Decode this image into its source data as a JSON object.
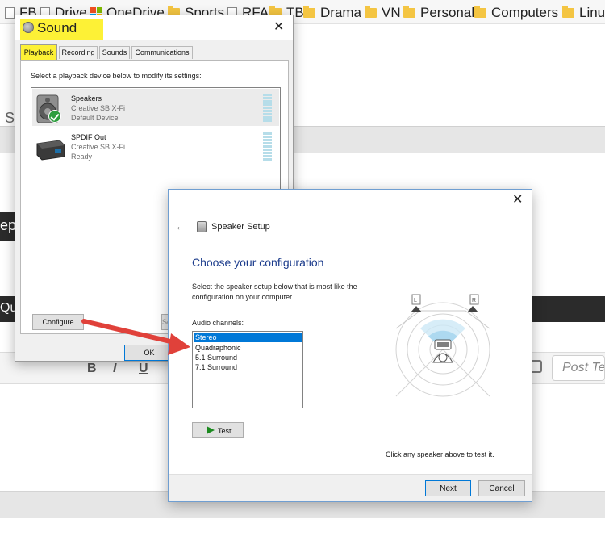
{
  "bookmarks": [
    {
      "label": "FB",
      "icon": "page-icon"
    },
    {
      "label": "Drive",
      "icon": "page-icon"
    },
    {
      "label": "OneDrive",
      "icon": "microsoft-icon"
    },
    {
      "label": "Sports",
      "icon": "folder-icon"
    },
    {
      "label": "RFA",
      "icon": "page-icon"
    },
    {
      "label": "TB",
      "icon": "folder-icon"
    },
    {
      "label": "Drama",
      "icon": "folder-icon"
    },
    {
      "label": "VN",
      "icon": "folder-icon"
    },
    {
      "label": "Personal",
      "icon": "folder-icon"
    },
    {
      "label": "Computers",
      "icon": "folder-icon"
    },
    {
      "label": "Linux",
      "icon": "folder-icon"
    }
  ],
  "background": {
    "sy_fragment": "Sy",
    "ep_fragment": "ep",
    "qu_fragment": "Qu",
    "post_text_placeholder": "Post Te",
    "tool_bold": "B",
    "tool_italic": "I",
    "tool_underline": "U"
  },
  "sound": {
    "title": "Sound",
    "close": "✕",
    "tabs": [
      "Playback",
      "Recording",
      "Sounds",
      "Communications"
    ],
    "active_tab": "Playback",
    "instruction": "Select a playback device below to modify its settings:",
    "devices": [
      {
        "name": "Speakers",
        "card": "Creative SB X-Fi",
        "status": "Default Device",
        "default": true
      },
      {
        "name": "SPDIF Out",
        "card": "Creative SB X-Fi",
        "status": "Ready",
        "default": false
      }
    ],
    "configure_label": "Configure",
    "set_default_fragment": "Se",
    "ok_label": "OK"
  },
  "setup": {
    "close": "✕",
    "back": "←",
    "title": "Speaker Setup",
    "heading": "Choose your configuration",
    "description": "Select the speaker setup below that is most like the configuration on your computer.",
    "channels_label": "Audio channels:",
    "channels": [
      "Stereo",
      "Quadraphonic",
      "5.1 Surround",
      "7.1 Surround"
    ],
    "selected_channel": "Stereo",
    "test_label": "Test",
    "hint": "Click any speaker above to test it.",
    "next_label": "Next",
    "cancel_label": "Cancel",
    "speaker_left": "L",
    "speaker_right": "R"
  },
  "colors": {
    "highlight": "#fdf136",
    "arrow": "#e0413a",
    "selection": "#0078d7",
    "heading": "#1c3c8c"
  }
}
